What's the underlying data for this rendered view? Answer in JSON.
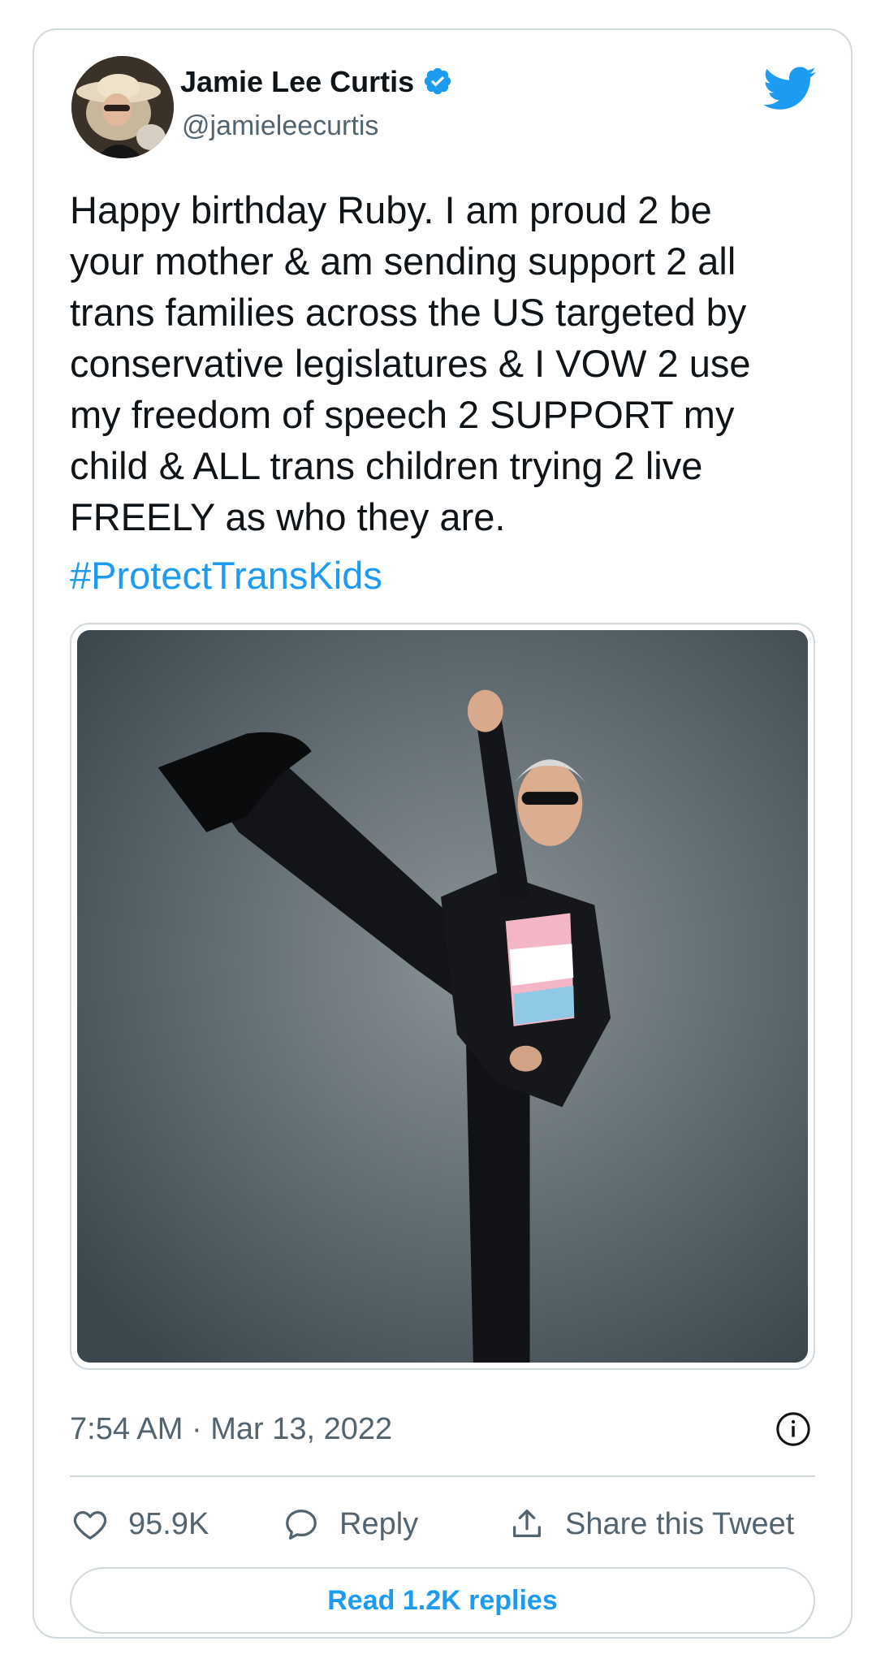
{
  "author": {
    "name": "Jamie Lee Curtis",
    "handle": "@jamieleecurtis",
    "verified": true,
    "avatar_icon": "profile-photo"
  },
  "platform_icon": "twitter-bird-icon",
  "tweet": {
    "text": "Happy birthday Ruby. I am proud 2 be\nyour mother & am sending support 2 all\ntrans families across the US targeted by\nconservative legislatures & I VOW 2 use\nmy freedom of speech 2 SUPPORT my\nchild & ALL trans children trying 2 live\nFREELY as who they are.",
    "hashtag": "#ProtectTransKids",
    "media_icon": "photo"
  },
  "meta": {
    "timestamp": "7:54 AM · Mar 13, 2022"
  },
  "actions": {
    "likes": "95.9K",
    "reply_label": "Reply",
    "share_label": "Share this Tweet"
  },
  "replies_button": "Read 1.2K replies",
  "colors": {
    "accent": "#1d9bf0",
    "text": "#0f1419",
    "secondary": "#536471",
    "border": "#cfd9de"
  }
}
